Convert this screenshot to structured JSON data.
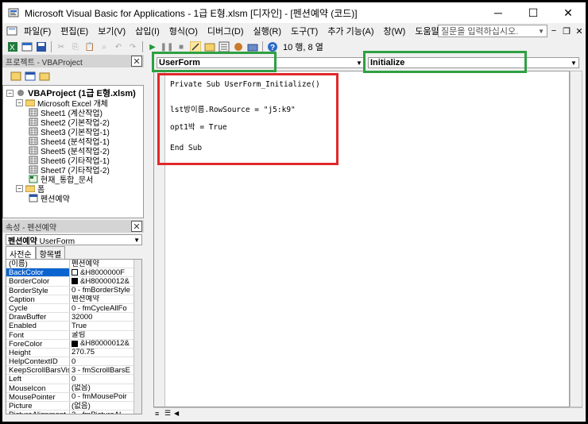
{
  "window": {
    "title": "Microsoft Visual Basic for Applications - 1급 E형.xlsm [디자인] - [펜션예약 (코드)]",
    "min": "─",
    "max": "☐",
    "close": "✕"
  },
  "menu": {
    "items": [
      "파일(F)",
      "편집(E)",
      "보기(V)",
      "삽입(I)",
      "형식(O)",
      "디버그(D)",
      "실행(R)",
      "도구(T)",
      "추가 기능(A)",
      "창(W)",
      "도움말(H)"
    ],
    "ask_placeholder": "질문을 입력하십시오."
  },
  "toolbar": {
    "position": "10 행, 8 열"
  },
  "project": {
    "title": "프로젝트 - VBAProject",
    "root": "VBAProject (1급 E형.xlsm)",
    "excel_folder": "Microsoft Excel 개체",
    "sheets": [
      "Sheet1 (계산작업)",
      "Sheet2 (기본작업-2)",
      "Sheet3 (기본작업-1)",
      "Sheet4 (분석작업-1)",
      "Sheet5 (분석작업-2)",
      "Sheet6 (기타작업-1)",
      "Sheet7 (기타작업-2)",
      "현재_통합_문서"
    ],
    "forms_folder": "폼",
    "form": "펜션예약"
  },
  "properties": {
    "title": "속성 - 펜션예약",
    "object": "펜션예약",
    "object_type": "UserForm",
    "tabs": [
      "사전순",
      "항목별"
    ],
    "rows": [
      {
        "name": "(이름)",
        "value": "펜션예약",
        "swatch": ""
      },
      {
        "name": "BackColor",
        "value": "&H8000000F",
        "swatch": "#ffffff"
      },
      {
        "name": "BorderColor",
        "value": "&H80000012&",
        "swatch": "#000000"
      },
      {
        "name": "BorderStyle",
        "value": "0 - fmBorderStyle",
        "swatch": ""
      },
      {
        "name": "Caption",
        "value": "펜션예약",
        "swatch": ""
      },
      {
        "name": "Cycle",
        "value": "0 - fmCycleAllFo",
        "swatch": ""
      },
      {
        "name": "DrawBuffer",
        "value": "32000",
        "swatch": ""
      },
      {
        "name": "Enabled",
        "value": "True",
        "swatch": ""
      },
      {
        "name": "Font",
        "value": "굴림",
        "swatch": ""
      },
      {
        "name": "ForeColor",
        "value": "&H80000012&",
        "swatch": "#000000"
      },
      {
        "name": "Height",
        "value": "270.75",
        "swatch": ""
      },
      {
        "name": "HelpContextID",
        "value": "0",
        "swatch": ""
      },
      {
        "name": "KeepScrollBarsVis",
        "value": "3 - fmScrollBarsE",
        "swatch": ""
      },
      {
        "name": "Left",
        "value": "0",
        "swatch": ""
      },
      {
        "name": "MouseIcon",
        "value": "(없음)",
        "swatch": ""
      },
      {
        "name": "MousePointer",
        "value": "0 - fmMousePoir",
        "swatch": ""
      },
      {
        "name": "Picture",
        "value": "(없음)",
        "swatch": ""
      },
      {
        "name": "PictureAlignment",
        "value": "2 - fmPictureAl",
        "swatch": ""
      }
    ]
  },
  "code": {
    "object_combo": "UserForm",
    "proc_combo": "Initialize",
    "lines": [
      "Private Sub UserForm_Initialize()",
      "lst방이름.RowSource = \"j5:k9\"",
      "opt1박 = True",
      "End Sub"
    ]
  }
}
